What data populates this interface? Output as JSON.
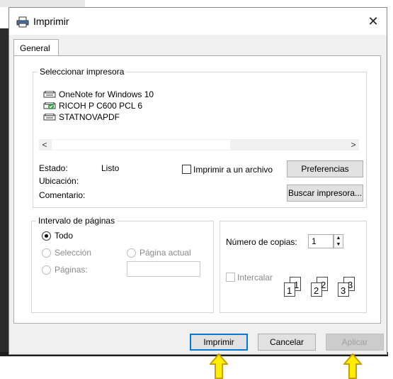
{
  "window": {
    "title": "Imprimir",
    "close_glyph": "✕"
  },
  "tabs": [
    {
      "label": "General"
    }
  ],
  "printer_group": {
    "legend": "Seleccionar impresora",
    "printers": [
      {
        "name": "OneNote for Windows 10",
        "icon": "printer-icon"
      },
      {
        "name": "RICOH P C600 PCL 6",
        "icon": "printer-check-icon"
      },
      {
        "name": "STATNOVAPDF",
        "icon": "printer-icon"
      }
    ],
    "scroll_left": "<",
    "scroll_right": ">",
    "status_label": "Estado:",
    "status_value": "Listo",
    "location_label": "Ubicación:",
    "comment_label": "Comentario:",
    "print_to_file_label": "Imprimir a un archivo",
    "preferences_button": "Preferencias",
    "find_printer_button": "Buscar impresora..."
  },
  "page_range": {
    "legend": "Intervalo de páginas",
    "all_label": "Todo",
    "selection_label": "Selección",
    "current_page_label": "Página actual",
    "pages_label": "Páginas:"
  },
  "copies": {
    "label": "Número de copias:",
    "value": "1",
    "collate_label": "Intercalar",
    "collate_numbers": [
      "1",
      "1",
      "2",
      "2",
      "3",
      "3"
    ]
  },
  "buttons": {
    "print": "Imprimir",
    "cancel": "Cancelar",
    "apply": "Aplicar"
  },
  "colors": {
    "arrow_fill": "#ffee00",
    "arrow_stroke": "#c8a000",
    "default_button_border": "#0078d7"
  }
}
